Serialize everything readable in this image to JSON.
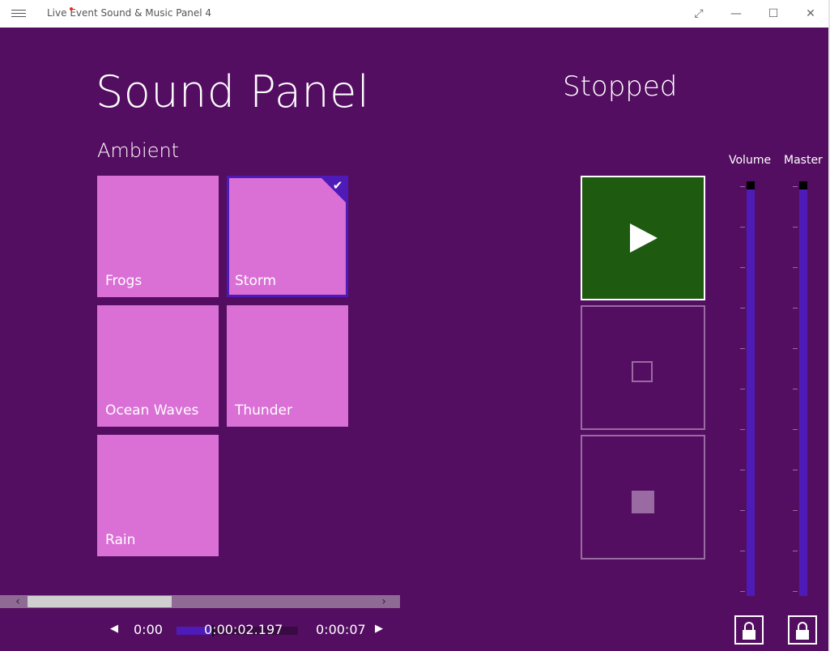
{
  "window": {
    "title": "Live Event Sound & Music Panel 4"
  },
  "page": {
    "title": "Sound Panel",
    "status": "Stopped"
  },
  "group": {
    "title": "Ambient"
  },
  "tiles": [
    {
      "label": "Frogs",
      "selected": false
    },
    {
      "label": "Storm",
      "selected": true
    },
    {
      "label": "Ocean Waves",
      "selected": false
    },
    {
      "label": "Thunder",
      "selected": false
    },
    {
      "label": "Rain",
      "selected": false
    }
  ],
  "controls": {
    "play": "play-icon",
    "pause": "pause-icon",
    "stop": "stop-icon"
  },
  "sliders": {
    "volume_label": "Volume",
    "master_label": "Master",
    "volume_level": 1.0,
    "master_level": 1.0
  },
  "transport": {
    "start_time": "0:00",
    "current_time": "0:00:02.197",
    "end_time": "0:00:07",
    "progress": 0.3
  },
  "colors": {
    "background": "#540e61",
    "tile": "#da70d6",
    "accent": "#4e1ab8",
    "play": "#1e5a10"
  }
}
